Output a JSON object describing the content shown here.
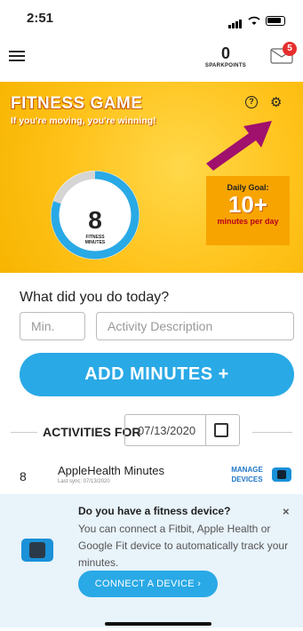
{
  "status": {
    "time": "2:51"
  },
  "header": {
    "points_value": "0",
    "points_label": "SPARKPOINTS",
    "mail_count": "5"
  },
  "hero": {
    "title": "FITNESS GAME",
    "subtitle": "If you're moving, you're winning!",
    "minutes_value": "8",
    "minutes_label": "FITNESS MINUTES",
    "goal_label": "Daily Goal:",
    "goal_value": "10+",
    "goal_unit": "minutes per day",
    "progress_fraction": 0.8
  },
  "form": {
    "question": "What did you do today?",
    "min_placeholder": "Min.",
    "desc_placeholder": "Activity Description",
    "add_button": "ADD MINUTES +"
  },
  "activities": {
    "label": "ACTIVITIES FOR",
    "date": "07/13/2020",
    "rows": [
      {
        "count": "8",
        "title": "AppleHealth Minutes",
        "sync": "Last sync: 07/13/2020",
        "action": "MANAGE DEVICES"
      }
    ]
  },
  "device_card": {
    "title": "Do you have a fitness device?",
    "close": "×",
    "body": "You can connect a Fitbit, Apple Health or Google Fit device to automatically track your minutes.",
    "button": "CONNECT A DEVICE  ›"
  },
  "colors": {
    "accent": "#29a9e6",
    "hero_yellow": "#ffc21a",
    "goal_orange": "#f7a400",
    "badge_red": "#e62e2e",
    "arrow_magenta": "#a0106d"
  }
}
